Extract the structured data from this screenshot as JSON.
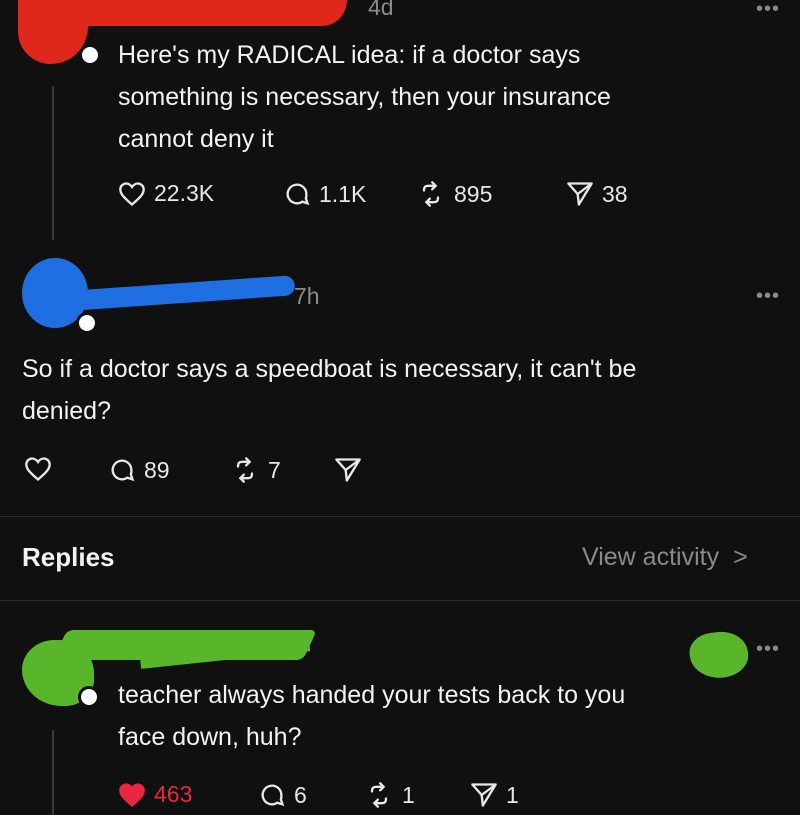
{
  "post1": {
    "age": "4d",
    "text_lines": [
      "Here's my RADICAL idea: if a doctor says",
      "something is necessary, then your  insurance",
      "cannot deny it"
    ],
    "likes": "22.3K",
    "replies": "1.1K",
    "reposts": "895",
    "shares": "38",
    "more": "•••"
  },
  "post2": {
    "age": "7h",
    "text_lines": [
      "So if a doctor says a speedboat is necessary, it can't be",
      "denied?"
    ],
    "replies": "89",
    "reposts": "7",
    "more": "•••"
  },
  "replies_header": {
    "label": "Replies",
    "view_activity": "View activity",
    "chevron": ">"
  },
  "reply1": {
    "text_lines": [
      "teacher always handed your tests back to you",
      "face down, huh?"
    ],
    "likes": "463",
    "replies": "6",
    "reposts": "1",
    "shares": "1",
    "more": "•••",
    "like_color": "#e8263f"
  },
  "colors": {
    "background": "#101010",
    "redaction_red": "#e0271c",
    "redaction_blue": "#1f6fe3",
    "redaction_green": "#59b52a"
  }
}
